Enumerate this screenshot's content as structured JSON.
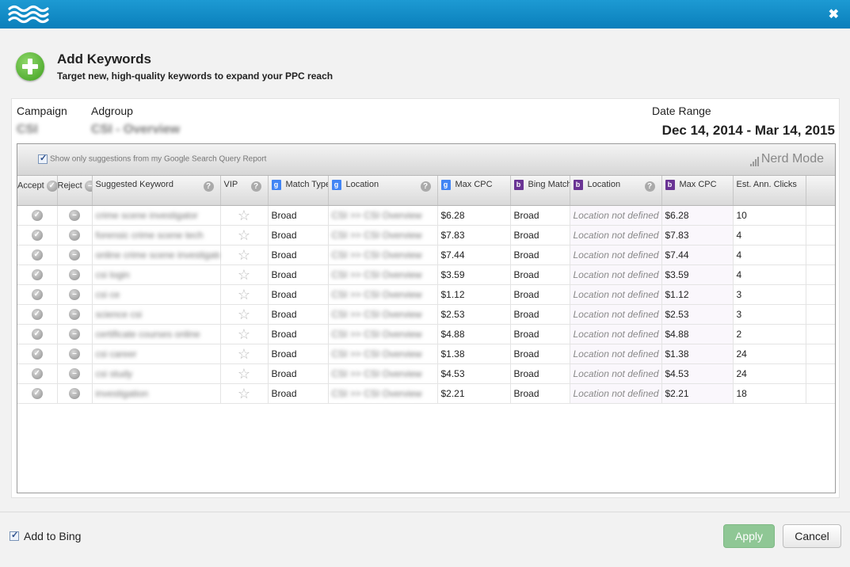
{
  "window": {
    "close_glyph": "✖"
  },
  "header": {
    "title": "Add Keywords",
    "subtitle": "Target new, high-quality keywords to expand your PPC reach"
  },
  "meta": {
    "campaign_label": "Campaign",
    "campaign_value": "CSI",
    "adgroup_label": "Adgroup",
    "adgroup_value": "CSI - Overview",
    "date_range_label": "Date Range",
    "date_range_value": "Dec 14, 2014 - Mar 14, 2015"
  },
  "toolbar": {
    "sqr_checkbox_label": "Show only suggestions from my Google Search Query Report",
    "sqr_checked": true,
    "nerd_mode_label": "Nerd Mode"
  },
  "columns": {
    "accept": "Accept",
    "reject": "Reject",
    "keyword": "Suggested Keyword",
    "vip": "VIP",
    "match_type": "Match Type",
    "location": "Location",
    "max_cpc": "Max CPC",
    "bing_match": "Bing Match",
    "bing_location": "Location",
    "bing_max_cpc": "Max CPC",
    "clicks": "Est. Ann. Clicks"
  },
  "icons": {
    "google_badge": "g",
    "bing_badge": "b",
    "help": "?",
    "accept": "✓",
    "reject": "–",
    "star": "☆"
  },
  "rows": [
    {
      "keyword": "crime scene investigator",
      "match": "Broad",
      "location": "CSI >> CSI Overview",
      "cpc": "$6.28",
      "bing_match": "Broad",
      "bing_location": "Location not defined",
      "bing_cpc": "$6.28",
      "clicks": "10"
    },
    {
      "keyword": "forensic crime scene tech",
      "match": "Broad",
      "location": "CSI >> CSI Overview",
      "cpc": "$7.83",
      "bing_match": "Broad",
      "bing_location": "Location not defined",
      "bing_cpc": "$7.83",
      "clicks": "4"
    },
    {
      "keyword": "online crime scene investigator",
      "match": "Broad",
      "location": "CSI >> CSI Overview",
      "cpc": "$7.44",
      "bing_match": "Broad",
      "bing_location": "Location not defined",
      "bing_cpc": "$7.44",
      "clicks": "4"
    },
    {
      "keyword": "csi login",
      "match": "Broad",
      "location": "CSI >> CSI Overview",
      "cpc": "$3.59",
      "bing_match": "Broad",
      "bing_location": "Location not defined",
      "bing_cpc": "$3.59",
      "clicks": "4"
    },
    {
      "keyword": "csi ce",
      "match": "Broad",
      "location": "CSI >> CSI Overview",
      "cpc": "$1.12",
      "bing_match": "Broad",
      "bing_location": "Location not defined",
      "bing_cpc": "$1.12",
      "clicks": "3"
    },
    {
      "keyword": "science csi",
      "match": "Broad",
      "location": "CSI >> CSI Overview",
      "cpc": "$2.53",
      "bing_match": "Broad",
      "bing_location": "Location not defined",
      "bing_cpc": "$2.53",
      "clicks": "3"
    },
    {
      "keyword": "certificate courses online",
      "match": "Broad",
      "location": "CSI >> CSI Overview",
      "cpc": "$4.88",
      "bing_match": "Broad",
      "bing_location": "Location not defined",
      "bing_cpc": "$4.88",
      "clicks": "2"
    },
    {
      "keyword": "csi career",
      "match": "Broad",
      "location": "CSI >> CSI Overview",
      "cpc": "$1.38",
      "bing_match": "Broad",
      "bing_location": "Location not defined",
      "bing_cpc": "$1.38",
      "clicks": "24"
    },
    {
      "keyword": "csi study",
      "match": "Broad",
      "location": "CSI >> CSI Overview",
      "cpc": "$4.53",
      "bing_match": "Broad",
      "bing_location": "Location not defined",
      "bing_cpc": "$4.53",
      "clicks": "24"
    },
    {
      "keyword": "investigation",
      "match": "Broad",
      "location": "CSI >> CSI Overview",
      "cpc": "$2.21",
      "bing_match": "Broad",
      "bing_location": "Location not defined",
      "bing_cpc": "$2.21",
      "clicks": "18"
    }
  ],
  "footer": {
    "add_to_bing_label": "Add to Bing",
    "add_to_bing_checked": true,
    "apply_label": "Apply",
    "cancel_label": "Cancel"
  }
}
